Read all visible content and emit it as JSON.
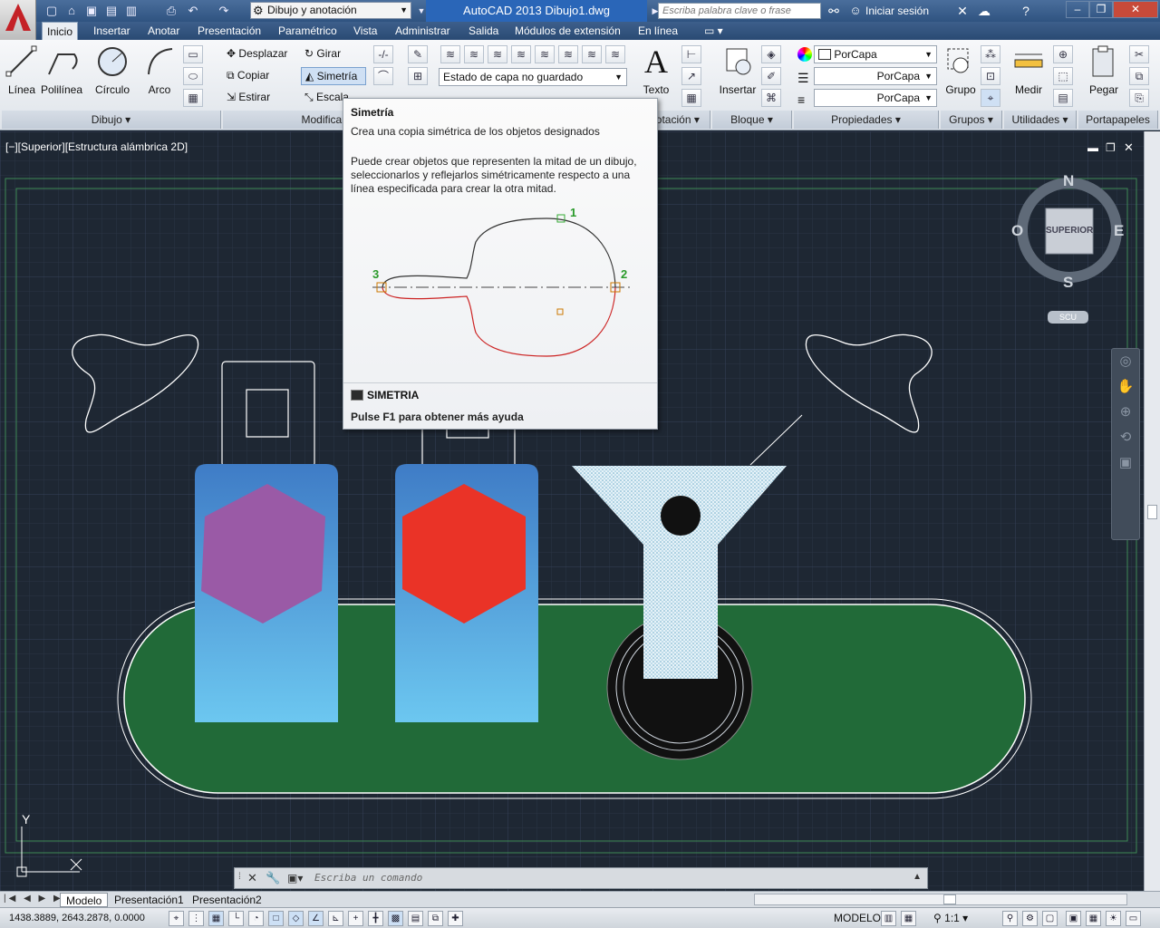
{
  "titlebar": {
    "workspace": "Dibujo y anotación",
    "title": "AutoCAD 2013    Dibujo1.dwg",
    "search_placeholder": "Escriba palabra clave o frase",
    "signin": "Iniciar sesión"
  },
  "tabs": [
    "Inicio",
    "Insertar",
    "Anotar",
    "Presentación",
    "Paramétrico",
    "Vista",
    "Administrar",
    "Salida",
    "Módulos de extensión",
    "En línea"
  ],
  "ribbon": {
    "draw": {
      "line": "Línea",
      "polyline": "Polilínea",
      "circle": "Círculo",
      "arc": "Arco",
      "panel": "Dibujo"
    },
    "modify": {
      "move": "Desplazar",
      "rotate": "Girar",
      "copy": "Copiar",
      "mirror": "Simetría",
      "stretch": "Estirar",
      "scale": "Escala",
      "panel": "Modificar"
    },
    "layers": {
      "state": "Estado de capa no guardado"
    },
    "annotation": {
      "text": "Texto",
      "panel": "Anotación"
    },
    "block": {
      "insert": "Insertar",
      "panel": "Bloque"
    },
    "properties": {
      "color": "PorCapa",
      "linetype": "PorCapa",
      "lineweight": "PorCapa",
      "panel": "Propiedades"
    },
    "groups": {
      "group": "Grupo",
      "panel": "Grupos"
    },
    "utilities": {
      "measure": "Medir",
      "panel": "Utilidades"
    },
    "clipboard": {
      "paste": "Pegar",
      "panel": "Portapapeles"
    }
  },
  "viewport": {
    "label": "[−][Superior][Estructura alámbrica 2D]",
    "viewcube": {
      "n": "N",
      "s": "S",
      "e": "E",
      "w": "O",
      "face": "SUPERIOR",
      "ucs": "SCU"
    },
    "axis_y": "Y"
  },
  "tooltip": {
    "title": "Simetría",
    "desc": "Crea una copia simétrica de los objetos designados",
    "long": "Puede crear objetos que representen la mitad de un dibujo, seleccionarlos y reflejarlos simétricamente respecto a una línea especificada para crear la otra mitad.",
    "n1": "1",
    "n2": "2",
    "n3": "3",
    "command": "SIMETRIA",
    "help": "Pulse F1 para obtener más ayuda"
  },
  "commandline": {
    "placeholder": "Escriba un comando"
  },
  "layout_tabs": [
    "Modelo",
    "Presentación1",
    "Presentación2"
  ],
  "status": {
    "coords": "1438.3889, 2643.2878, 0.0000",
    "mode": "MODELO",
    "scale": "1:1"
  },
  "colors": {
    "green": "#216a38",
    "hexPurple": "#9a5aa6",
    "hexRed": "#ea3327",
    "blueTop": "#3f7cc6",
    "blueBot": "#6cc7f0"
  }
}
